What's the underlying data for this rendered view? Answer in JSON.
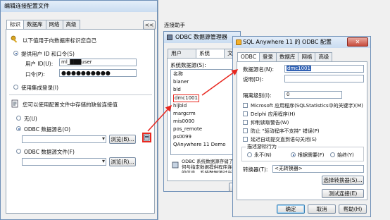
{
  "left_window": {
    "title": "编辑连接配置文件",
    "tabs": [
      "标识",
      "数据库",
      "网络",
      "高级"
    ],
    "active_tab": 0,
    "intro": "以下值用于向数据库标识您自己",
    "auth_option": "提供用户 ID 和口令(S)",
    "user_label": "用户 ID(U):",
    "user_value": "ml_███user",
    "pwd_label": "口令(P):",
    "pwd_value": "●●●●●●●●●●",
    "integrated_option": "使用集成登录(I)",
    "odbc_intro": "您可以使用配置文件中存储的缺省连接值",
    "none_option": "无(U)",
    "dsn_option": "ODBC 数据源名(O)",
    "browse1": "浏览(B)...",
    "file_option": "ODBC 数据源文件(F)",
    "browse2": "浏览(R)..."
  },
  "collapse_button": "<<",
  "assistant_title": "连接助手",
  "odbc_admin": {
    "title": "ODBC 数据源管理器",
    "tabs": [
      "用户 DSN",
      "系统 DSN",
      "文件"
    ],
    "active_tab": 1,
    "list_label": "系统数据源(S):",
    "col_name": "名称",
    "items": [
      "bianer",
      "bld",
      "dmc1001",
      "hljbld",
      "margcrm",
      "mis0000",
      "pos_remote",
      "ps0099",
      "QAnywhere 11 Demo"
    ],
    "highlighted_item": "dmc1001",
    "footnote": "ODBC 系统数据源存储了如何与指定数据提供程序连接的信息。系统数据源对当前机器上的所有用户可见",
    "ok_button": "确"
  },
  "sqla_dialog": {
    "title": "SQL Anywhere 11 的 ODBC 配置",
    "tabs": [
      "ODBC",
      "登录",
      "数据库",
      "网络",
      "高级"
    ],
    "active_tab": 0,
    "dsn_label": "数据源名(N):",
    "dsn_value": "dmc1001",
    "desc_label": "说明(D):",
    "desc_value": "",
    "isolation_label": "隔离级别(I):",
    "isolation_value": "0",
    "options": [
      {
        "label": "Microsoft 应用程序(SQLStatistics中的关键字)(M)",
        "checked": false
      },
      {
        "label": "Delphi 应用程序(H)",
        "checked": false
      },
      {
        "label": "抑制读取警告(W)",
        "checked": false
      },
      {
        "label": "防止 \"驱动程序不支持\" 错误(P)",
        "checked": false
      },
      {
        "label": "延迟自动提交直到语句关闭(S)",
        "checked": false
      }
    ],
    "cursor_group": "描述游标行为",
    "cursor_never": "永不(N)",
    "cursor_ondemand": "根据需要(F)",
    "cursor_always": "始终(Y)",
    "translator_label": "转换器(T):",
    "translator_value": "<无转换器>",
    "select_translator": "选择转换器(S)...",
    "test_connection": "测试连接(E)",
    "ok": "确定",
    "cancel": "取消",
    "help": "帮助(H)"
  },
  "colors": {
    "callout": "#e8271f",
    "titlebar": "#c9dcf1",
    "highlight": "#3162b5"
  }
}
